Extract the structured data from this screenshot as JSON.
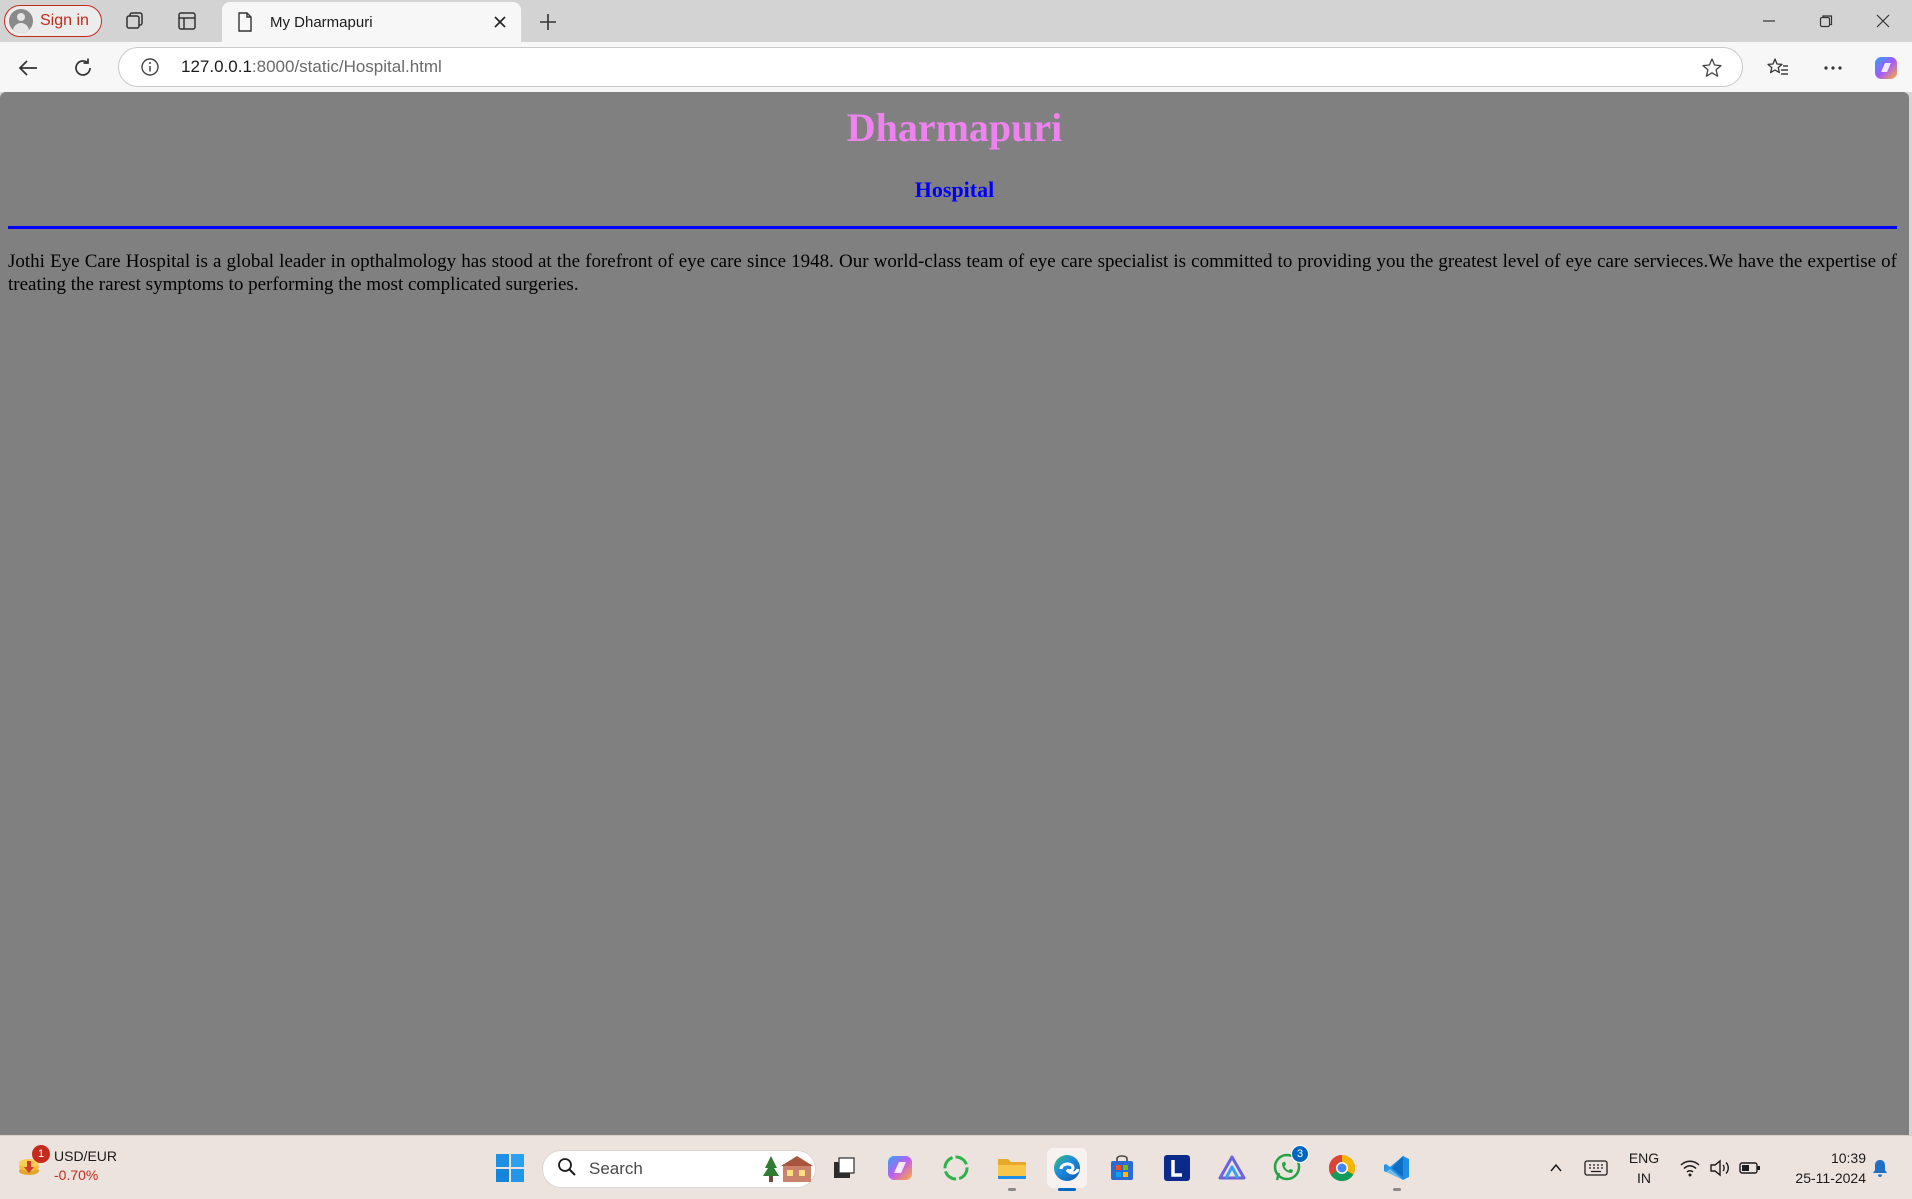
{
  "browser": {
    "sign_in_label": "Sign in",
    "tab_title": "My Dharmapuri",
    "url_host": "127.0.0.1",
    "url_rest": ":8000/static/Hospital.html"
  },
  "page": {
    "heading": "Dharmapuri",
    "subheading": "Hospital",
    "paragraph": "Jothi Eye Care Hospital is a global leader in opthalmology has stood at the forefront of eye care since 1948. Our world-class team of eye care specialist is committed to providing you the greatest level of eye care servieces.We have the expertise of treating the rarest symptoms to performing the most complicated surgeries.",
    "colors": {
      "background": "#808080",
      "heading": "#ee82ee",
      "subheading": "#0000ff",
      "rule": "#0000ff"
    }
  },
  "taskbar": {
    "widget_badge": "1",
    "widget_pair": "USD/EUR",
    "widget_change": "-0.70%",
    "search_placeholder": "Search",
    "whatsapp_badge": "3",
    "lang_line1": "ENG",
    "lang_line2": "IN",
    "time": "10:39",
    "date": "25-11-2024"
  },
  "icons": [
    "profile-icon",
    "workspaces-icon",
    "tab-actions-icon",
    "page-icon",
    "close-icon",
    "plus-icon",
    "minimize-icon",
    "restore-icon",
    "back-icon",
    "refresh-icon",
    "info-icon",
    "favorite-star-icon",
    "favorites-icon",
    "more-icon",
    "copilot-icon",
    "windows-start-icon",
    "search-icon",
    "task-view-icon",
    "folder-icon",
    "edge-icon",
    "store-icon",
    "whatsapp-icon",
    "chrome-icon",
    "vscode-icon",
    "wifi-icon",
    "volume-icon",
    "battery-icon",
    "bell-icon"
  ]
}
